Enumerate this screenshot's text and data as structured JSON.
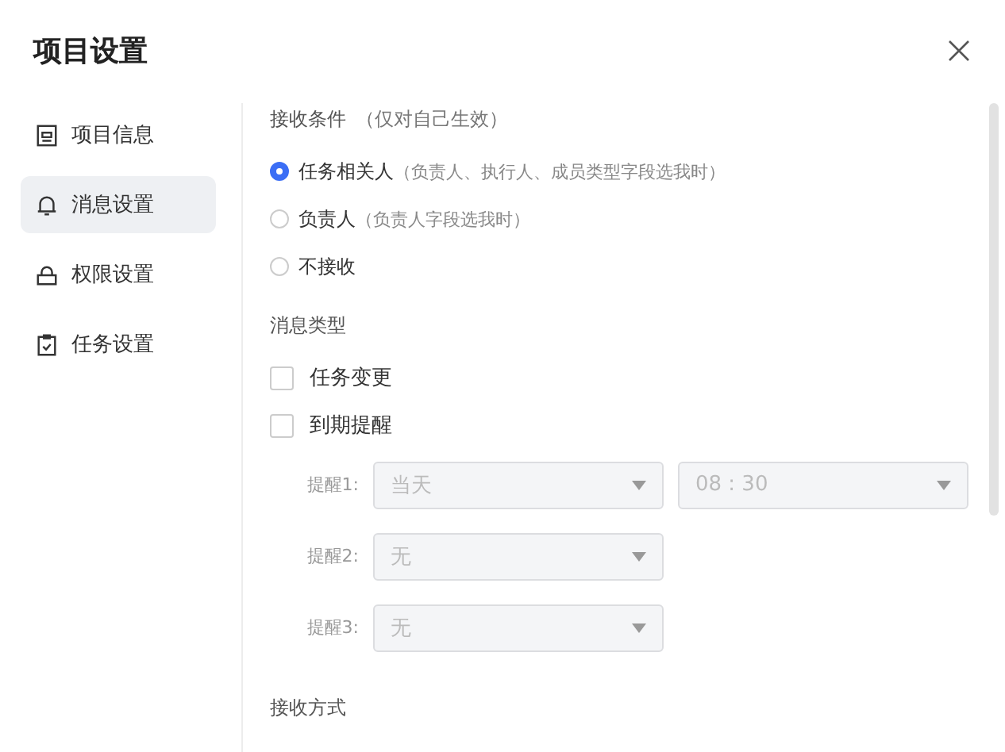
{
  "window": {
    "title": "项目设置"
  },
  "sidebar": {
    "items": [
      {
        "label": "项目信息",
        "selected": false
      },
      {
        "label": "消息设置",
        "selected": true
      },
      {
        "label": "权限设置",
        "selected": false
      },
      {
        "label": "任务设置",
        "selected": false
      }
    ]
  },
  "receive_condition": {
    "label": "接收条件",
    "hint": "（仅对自己生效）",
    "options": [
      {
        "label": "任务相关人",
        "hint": "（负责人、执行人、成员类型字段选我时）",
        "selected": true
      },
      {
        "label": "负责人",
        "hint": "（负责人字段选我时）",
        "selected": false
      },
      {
        "label": "不接收",
        "selected": false
      }
    ]
  },
  "message_types": {
    "label": "消息类型",
    "options": [
      {
        "label": "任务变更",
        "checked": false
      },
      {
        "label": "到期提醒",
        "checked": false
      }
    ]
  },
  "reminders": [
    {
      "label": "提醒1:",
      "selects": [
        {
          "value": "当天",
          "disabled": true
        },
        {
          "value": "08 : 30",
          "disabled": true
        }
      ]
    },
    {
      "label": "提醒2:",
      "selects": [
        {
          "value": "无",
          "disabled": true
        }
      ]
    },
    {
      "label": "提醒3:",
      "selects": [
        {
          "value": "无",
          "disabled": true
        }
      ]
    }
  ],
  "receive_method": {
    "label": "接收方式"
  }
}
